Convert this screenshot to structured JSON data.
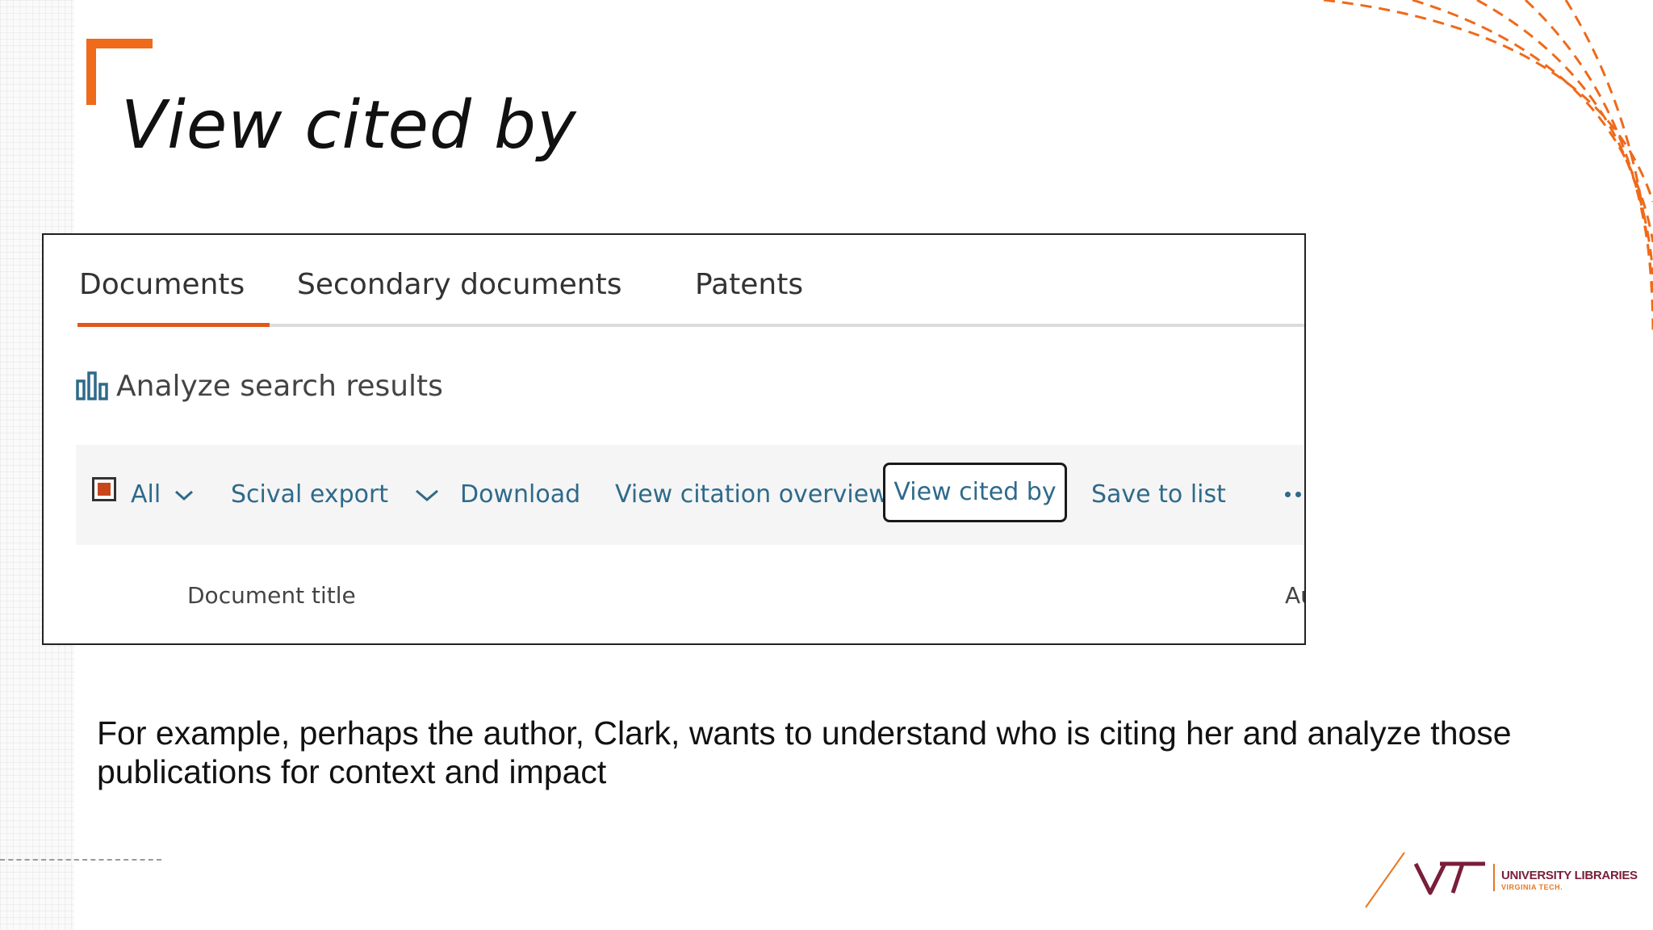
{
  "slide": {
    "title": "View cited by",
    "body_text": "For example, perhaps the author, Clark, wants to understand who is citing her and analyze those publications for context and impact"
  },
  "screenshot": {
    "tabs": [
      {
        "label": "Documents",
        "active": true
      },
      {
        "label": "Secondary documents",
        "active": false
      },
      {
        "label": "Patents",
        "active": false
      }
    ],
    "analyze_label": "Analyze search results",
    "analyze_icon": "bar-chart-icon",
    "toolbar": {
      "select_all_label": "All",
      "scival_export_label": "Scival export",
      "download_label": "Download",
      "view_citation_overview_label": "View citation overview",
      "view_cited_by_label": "View cited by",
      "save_to_list_label": "Save to list",
      "more_icon": "more-options-icon"
    },
    "columns": {
      "document_title": "Document title",
      "truncated_next": "Au"
    }
  },
  "logo": {
    "name": "UNIVERSITY LIBRARIES",
    "sub": "VIRGINIA TECH."
  },
  "colors": {
    "accent_orange": "#ef6a1a",
    "tab_active_underline": "#e0581c",
    "link_blue": "#2e6a8a",
    "checkbox_fill": "#c7471b",
    "vt_maroon": "#7a1e3a"
  }
}
